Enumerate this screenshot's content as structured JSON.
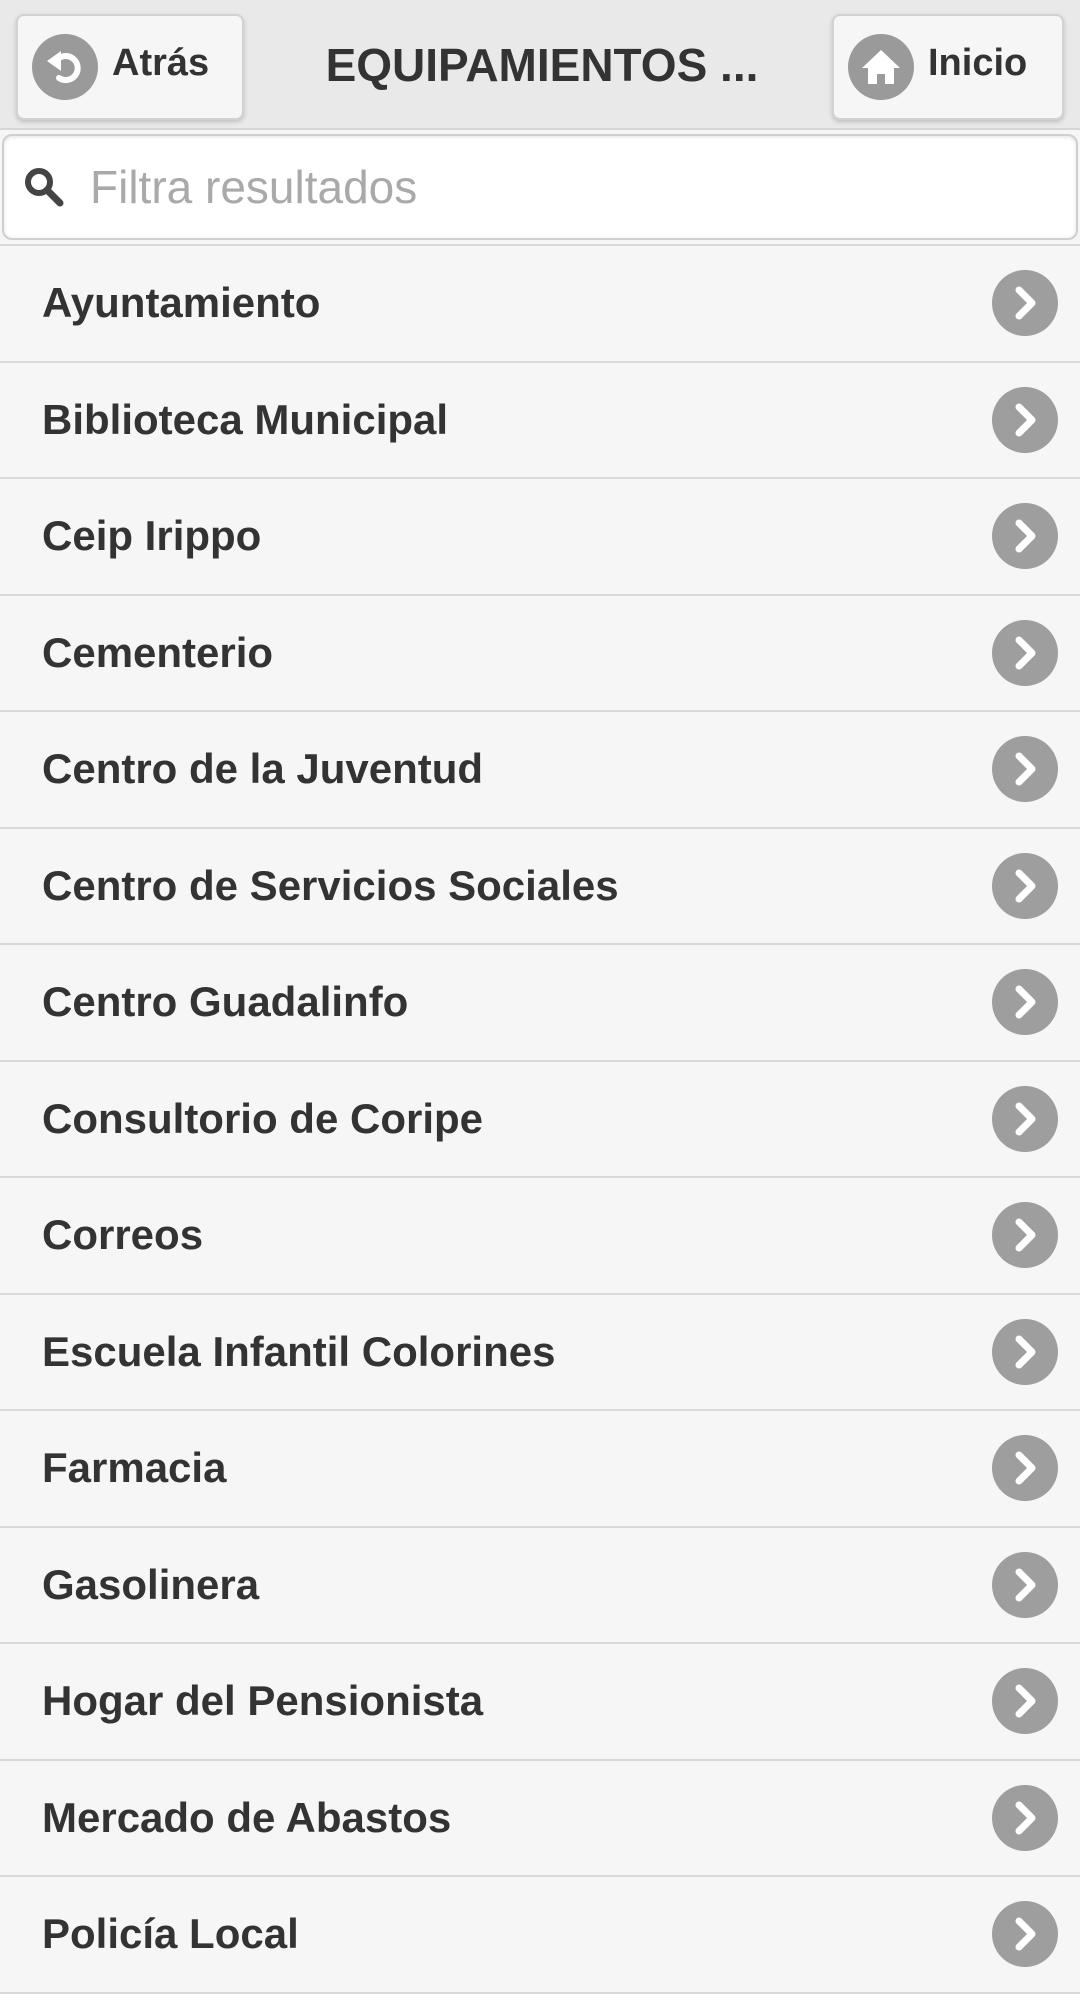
{
  "header": {
    "back_label": "Atrás",
    "title": "EQUIPAMIENTOS ...",
    "home_label": "Inicio"
  },
  "search": {
    "placeholder": "Filtra resultados",
    "value": ""
  },
  "list": {
    "items": [
      {
        "label": "Ayuntamiento"
      },
      {
        "label": "Biblioteca Municipal"
      },
      {
        "label": "Ceip Irippo"
      },
      {
        "label": "Cementerio"
      },
      {
        "label": "Centro de la Juventud"
      },
      {
        "label": "Centro de Servicios Sociales"
      },
      {
        "label": "Centro Guadalinfo"
      },
      {
        "label": "Consultorio de Coripe"
      },
      {
        "label": "Correos"
      },
      {
        "label": "Escuela Infantil Colorines"
      },
      {
        "label": "Farmacia"
      },
      {
        "label": "Gasolinera"
      },
      {
        "label": "Hogar del Pensionista"
      },
      {
        "label": "Mercado de Abastos"
      },
      {
        "label": "Policía Local"
      }
    ]
  },
  "icons": {
    "back": "undo-arrow-icon",
    "home": "home-icon",
    "search": "search-icon",
    "item_chevron": "chevron-right-icon"
  },
  "colors": {
    "header_bg": "#e9e9e9",
    "list_bg": "#f6f6f6",
    "icon_circle": "#9e9e9e",
    "text": "#333333"
  }
}
